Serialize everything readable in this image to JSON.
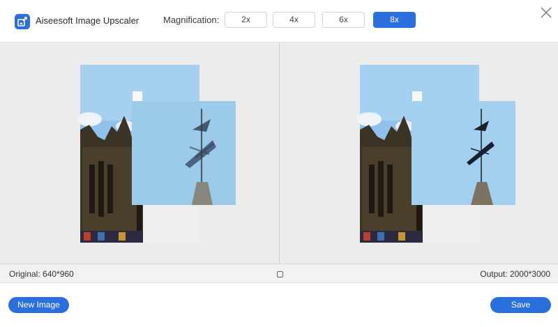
{
  "header": {
    "app_title": "Aiseesoft Image Upscaler",
    "magnification_label": "Magnification:",
    "magnification_options": [
      "2x",
      "4x",
      "6x",
      "8x"
    ],
    "selected_magnification": "8x"
  },
  "status": {
    "original": "Original: 640*960",
    "output": "Output: 2000*3000"
  },
  "footer": {
    "new_image_label": "New Image",
    "save_label": "Save"
  },
  "colors": {
    "accent": "#2a6fdc",
    "preview_background": "#ececec"
  },
  "icons": {
    "app": "app-logo-icon",
    "close": "close-icon",
    "fit": "fit-view-icon"
  }
}
